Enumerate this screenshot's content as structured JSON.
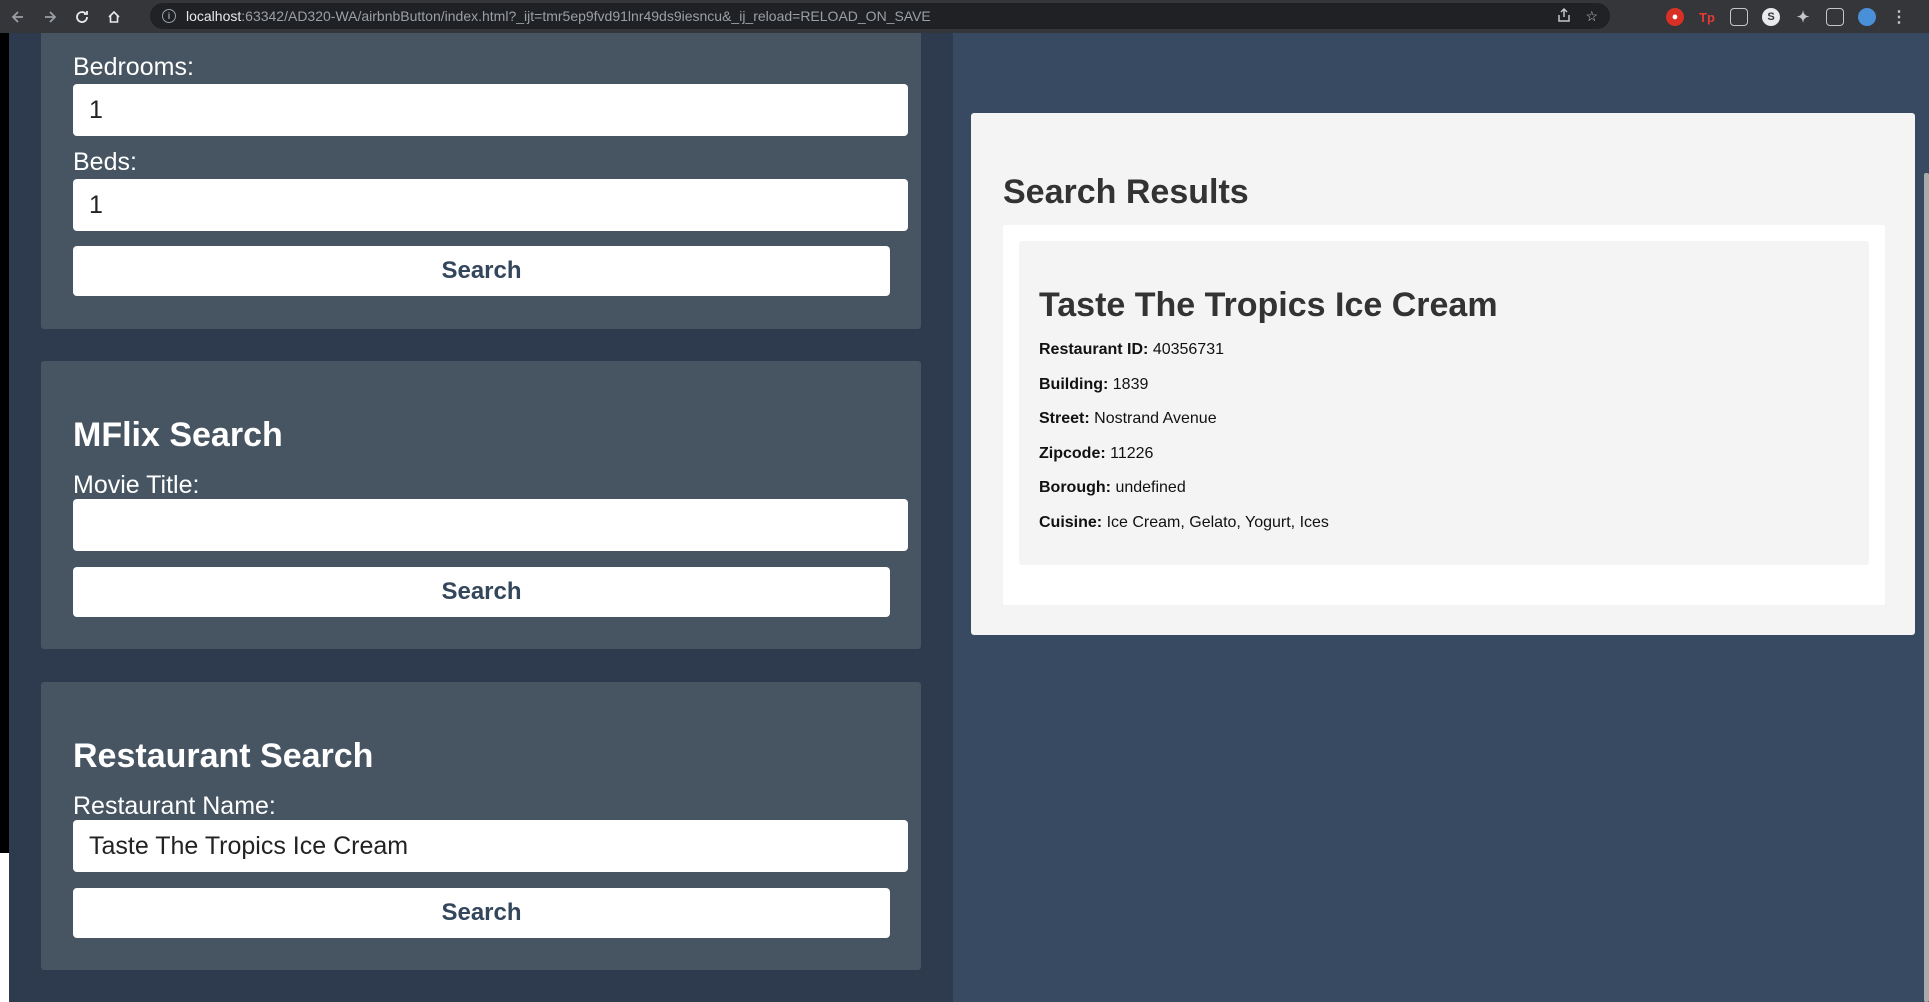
{
  "browser": {
    "url_host": "localhost",
    "url_rest": ":63342/AD320-WA/airbnbButton/index.html?_ijt=tmr5ep9fvd91lnr49ds9iesncu&_ij_reload=RELOAD_ON_SAVE"
  },
  "airbnb": {
    "bedrooms_label": "Bedrooms:",
    "bedrooms_value": "1",
    "beds_label": "Beds:",
    "beds_value": "1",
    "search_label": "Search"
  },
  "mflix": {
    "title": "MFlix Search",
    "movie_label": "Movie Title:",
    "movie_value": "",
    "search_label": "Search"
  },
  "restaurant": {
    "title": "Restaurant Search",
    "name_label": "Restaurant Name:",
    "name_value": "Taste The Tropics Ice Cream",
    "search_label": "Search"
  },
  "results": {
    "title": "Search Results",
    "item": {
      "name": "Taste The Tropics Ice Cream",
      "details": [
        {
          "label": "Restaurant ID:",
          "value": "40356731"
        },
        {
          "label": "Building:",
          "value": "1839"
        },
        {
          "label": "Street:",
          "value": "Nostrand Avenue"
        },
        {
          "label": "Zipcode:",
          "value": "11226"
        },
        {
          "label": "Borough:",
          "value": "undefined"
        },
        {
          "label": "Cuisine:",
          "value": "Ice Cream, Gelato, Yogurt, Ices"
        }
      ]
    }
  },
  "icons": {
    "back": "back-arrow-icon",
    "forward": "forward-arrow-icon",
    "reload": "reload-icon",
    "home": "home-icon",
    "info": "info-icon",
    "share": "share-icon",
    "bookmark": "star-icon",
    "extensions": "puzzle-icon",
    "sidepanel": "side-panel-icon",
    "profile": "profile-avatar-icon",
    "menu": "kebab-menu-icon"
  }
}
